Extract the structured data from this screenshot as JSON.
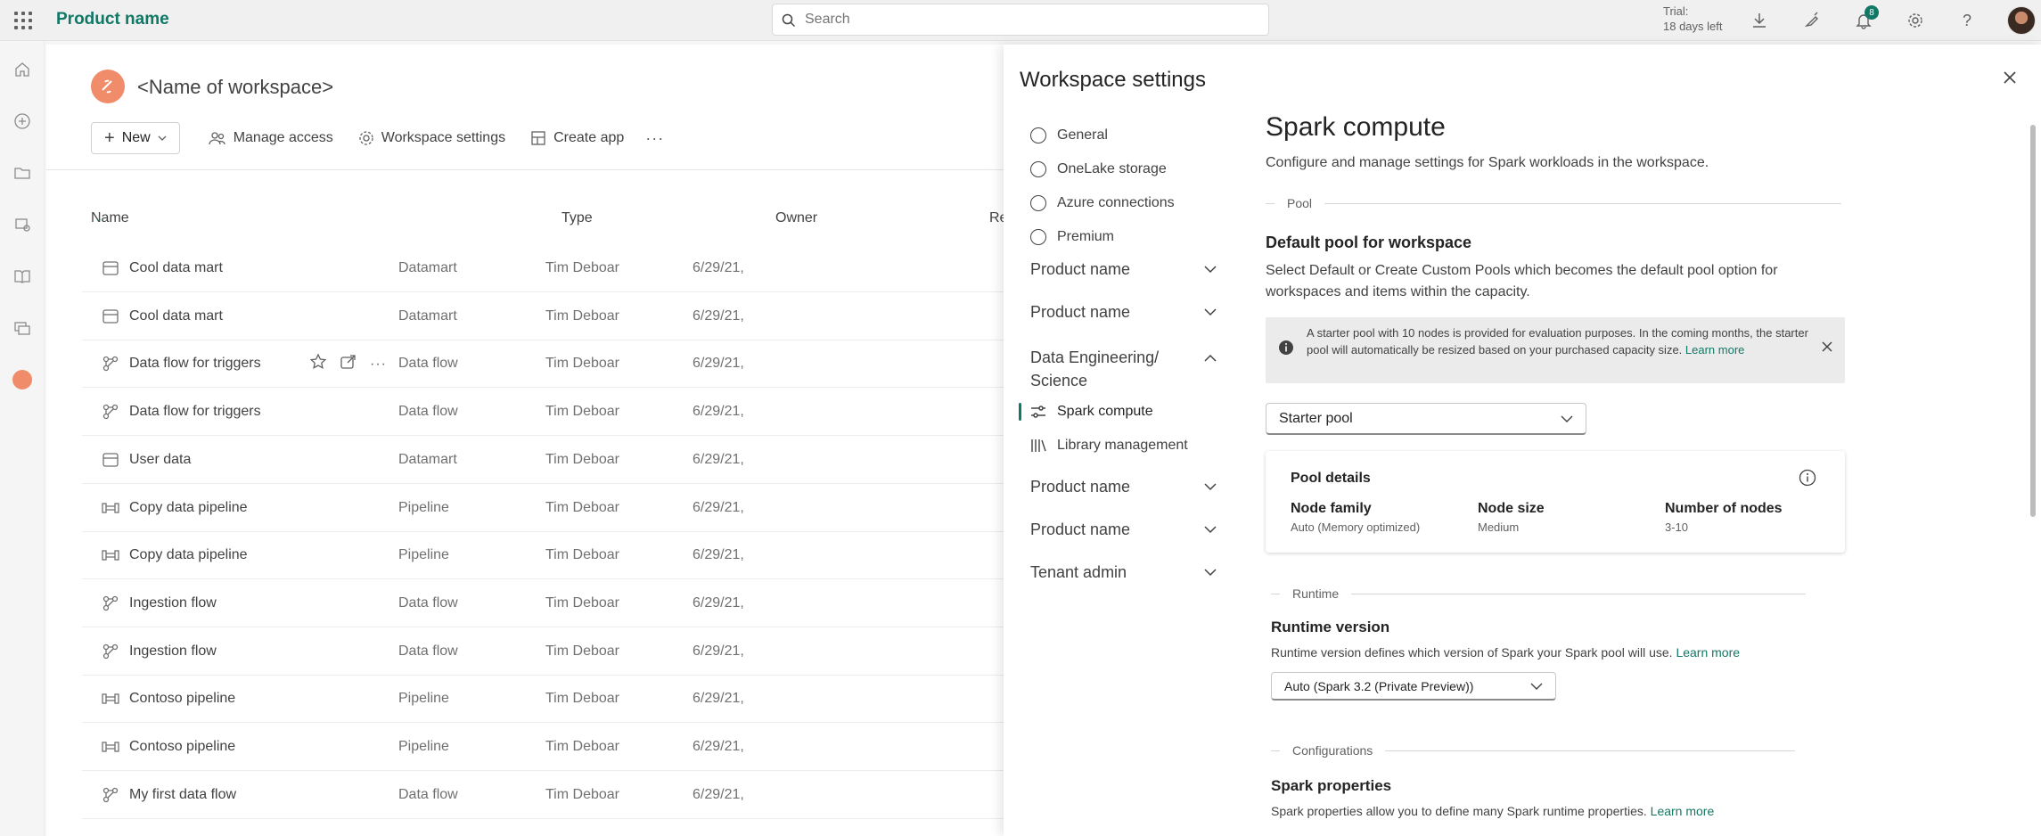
{
  "topbar": {
    "product_name": "Product name",
    "search_placeholder": "Search",
    "trial_line1": "Trial:",
    "trial_line2": "18 days left",
    "notification_count": "8"
  },
  "workspace": {
    "title": "<Name of workspace>",
    "toolbar": {
      "new_label": "New",
      "manage_access_label": "Manage access",
      "workspace_settings_label": "Workspace settings",
      "create_app_label": "Create app",
      "more_label": "···"
    },
    "columns": {
      "name": "Name",
      "type": "Type",
      "owner": "Owner",
      "refreshed": "Refreshe"
    },
    "rows": [
      {
        "name": "Cool data mart",
        "type": "Datamart",
        "owner": "Tim Deboar",
        "date": "6/29/21,",
        "icon": "datamart-icon"
      },
      {
        "name": "Cool data mart",
        "type": "Datamart",
        "owner": "Tim Deboar",
        "date": "6/29/21,",
        "icon": "datamart-icon"
      },
      {
        "name": "Data flow for triggers",
        "type": "Data flow",
        "owner": "Tim Deboar",
        "date": "6/29/21,",
        "icon": "dataflow-icon"
      },
      {
        "name": "Data flow for triggers",
        "type": "Data flow",
        "owner": "Tim Deboar",
        "date": "6/29/21,",
        "icon": "dataflow-icon"
      },
      {
        "name": "User data",
        "type": "Datamart",
        "owner": "Tim Deboar",
        "date": "6/29/21,",
        "icon": "datamart-icon"
      },
      {
        "name": "Copy data pipeline",
        "type": "Pipeline",
        "owner": "Tim Deboar",
        "date": "6/29/21,",
        "icon": "pipeline-icon"
      },
      {
        "name": "Copy data pipeline",
        "type": "Pipeline",
        "owner": "Tim Deboar",
        "date": "6/29/21,",
        "icon": "pipeline-icon"
      },
      {
        "name": "Ingestion flow",
        "type": "Data flow",
        "owner": "Tim Deboar",
        "date": "6/29/21,",
        "icon": "dataflow-icon"
      },
      {
        "name": "Ingestion flow",
        "type": "Data flow",
        "owner": "Tim Deboar",
        "date": "6/29/21,",
        "icon": "dataflow-icon"
      },
      {
        "name": "Contoso pipeline",
        "type": "Pipeline",
        "owner": "Tim Deboar",
        "date": "6/29/21,",
        "icon": "pipeline-icon"
      },
      {
        "name": "Contoso pipeline",
        "type": "Pipeline",
        "owner": "Tim Deboar",
        "date": "6/29/21,",
        "icon": "pipeline-icon"
      },
      {
        "name": "My first data flow",
        "type": "Data flow",
        "owner": "Tim Deboar",
        "date": "6/29/21,",
        "icon": "dataflow-icon"
      }
    ]
  },
  "panel": {
    "title": "Workspace settings",
    "nav": {
      "general": "General",
      "onelake": "OneLake storage",
      "azure": "Azure connections",
      "premium": "Premium",
      "group1": "Product name",
      "group2": "Product name",
      "data_eng_line1": "Data Engineering/",
      "data_eng_line2": "Science",
      "spark_compute": "Spark compute",
      "library_management": "Library management",
      "group3": "Product name",
      "group4": "Product name",
      "tenant_admin": "Tenant admin"
    },
    "content": {
      "heading": "Spark compute",
      "description": "Configure and manage settings for Spark workloads in the workspace.",
      "pool_section": "Pool",
      "default_pool_heading": "Default pool for workspace",
      "default_pool_desc_1": "Select Default or Create Custom Pools which becomes the default pool option for",
      "default_pool_desc_2": "workspaces and items within the capacity.",
      "info_text": "A starter pool with 10 nodes is provided for evaluation purposes. In the coming months, the starter pool will automatically be resized based on your purchased capacity size.",
      "info_link": "Learn more",
      "pool_select": "Starter pool",
      "pool_details_title": "Pool details",
      "node_family_label": "Node family",
      "node_family_value": "Auto (Memory optimized)",
      "node_size_label": "Node size",
      "node_size_value": "Medium",
      "nodes_label": "Number of nodes",
      "nodes_value": "3-10",
      "runtime_section": "Runtime",
      "runtime_heading": "Runtime version",
      "runtime_desc": "Runtime version defines which version of Spark your Spark pool will use.",
      "runtime_link": "Learn more",
      "runtime_select": "Auto (Spark 3.2 (Private Preview))",
      "config_section": "Configurations",
      "spark_props_heading": "Spark properties",
      "spark_props_desc": "Spark properties allow you to define many Spark runtime properties.",
      "spark_props_link": "Learn more"
    }
  },
  "colors": {
    "accent": "#117865",
    "workspace_logo": "#f08c6a"
  }
}
